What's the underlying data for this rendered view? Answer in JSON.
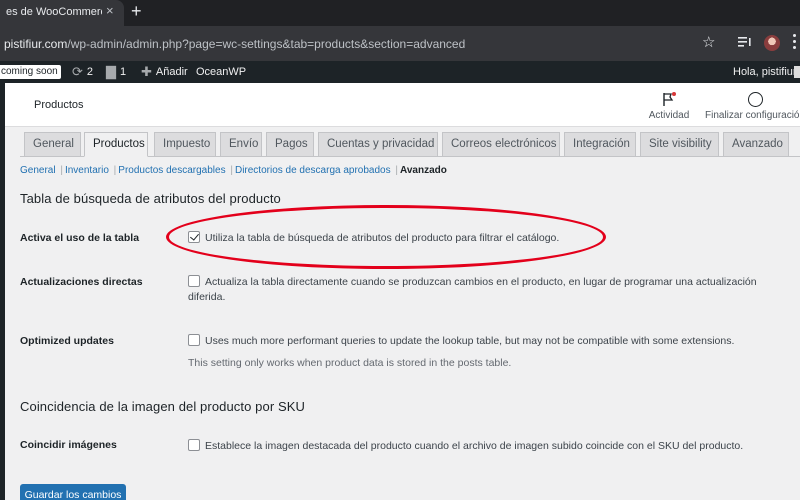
{
  "browser": {
    "tab_title": "es de WooCommerce ‹",
    "tab_close": "×",
    "new_tab": "+",
    "url_host": "pistifiur.com",
    "url_path": "/wp-admin/admin.php?page=wc-settings&tab=products&section=advanced"
  },
  "adminbar": {
    "coming_soon": "coming soon",
    "updates_count": "2",
    "comments_count": "1",
    "add_new": "Añadir",
    "theme": "OceanWP",
    "greeting": "Hola, pistifiur"
  },
  "wc_header": {
    "title": "Productos",
    "activity": "Actividad",
    "finalize": "Finalizar configuración"
  },
  "tabs": [
    {
      "label": "General",
      "active": false
    },
    {
      "label": "Productos",
      "active": true
    },
    {
      "label": "Impuesto",
      "active": false
    },
    {
      "label": "Envío",
      "active": false
    },
    {
      "label": "Pagos",
      "active": false
    },
    {
      "label": "Cuentas y privacidad",
      "active": false
    },
    {
      "label": "Correos electrónicos",
      "active": false
    },
    {
      "label": "Integración",
      "active": false
    },
    {
      "label": "Site visibility",
      "active": false
    },
    {
      "label": "Avanzado",
      "active": false
    }
  ],
  "subsections": {
    "general": "General",
    "inventario": "Inventario",
    "descargables": "Productos descargables",
    "directorios": "Directorios de descarga aprobados",
    "avanzado": "Avanzado",
    "sep": "|"
  },
  "section1": {
    "heading": "Tabla de búsqueda de atributos del producto",
    "rows": [
      {
        "label": "Activa el uso de la tabla",
        "text": "Utiliza la tabla de búsqueda de atributos del producto para filtrar el catálogo.",
        "checked": true
      },
      {
        "label": "Actualizaciones directas",
        "text": "Actualiza la tabla directamente cuando se produzcan cambios en el producto, en lugar de programar una actualización diferida.",
        "checked": false
      },
      {
        "label": "Optimized updates",
        "text": "Uses much more performant queries to update the lookup table, but may not be compatible with some extensions.",
        "desc": "This setting only works when product data is stored in the posts table.",
        "checked": false
      }
    ]
  },
  "section2": {
    "heading": "Coincidencia de la imagen del producto por SKU",
    "rows": [
      {
        "label": "Coincidir imágenes",
        "text": "Establece la imagen destacada del producto cuando el archivo de imagen subido coincide con el SKU del producto.",
        "checked": false
      }
    ]
  },
  "save_button": "Guardar los cambios",
  "colors": {
    "admin_bar": "#1d2327",
    "primary_button": "#2271b1",
    "highlight_ellipse": "#e3001b"
  }
}
